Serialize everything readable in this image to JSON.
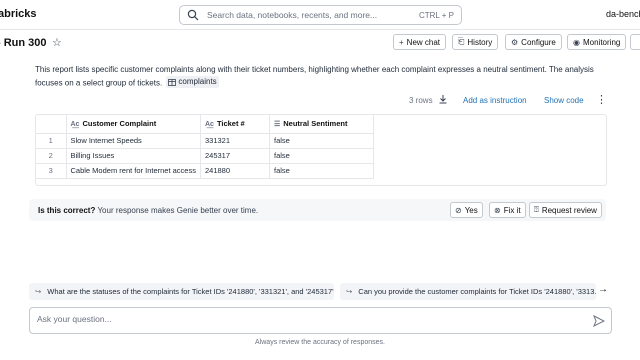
{
  "topbar": {
    "brand": "abricks",
    "search_placeholder": "Search data, notebooks, recents, and more...",
    "search_shortcut": "CTRL + P",
    "workspace": "da-bench"
  },
  "titlebar": {
    "title": "- Run 300",
    "buttons": {
      "new_chat": "New chat",
      "history": "History",
      "configure": "Configure",
      "monitoring": "Monitoring"
    }
  },
  "message": {
    "text": "This report lists specific customer complaints along with their ticket numbers, highlighting whether each complaint expresses a neutral sentiment. The analysis focuses on a select group of tickets.",
    "table_chip": "complaints"
  },
  "result_toolbar": {
    "rows": "3 rows",
    "add_instruction": "Add as instruction",
    "show_code": "Show code"
  },
  "table": {
    "columns": [
      "Customer Complaint",
      "Ticket #",
      "Neutral Sentiment"
    ],
    "rows": [
      {
        "idx": "1",
        "complaint": "Slow Internet Speeds",
        "ticket": "331321",
        "neutral": "false"
      },
      {
        "idx": "2",
        "complaint": "Billing Issues",
        "ticket": "245317",
        "neutral": "false"
      },
      {
        "idx": "3",
        "complaint": "Cable Modem rent for Internet access",
        "ticket": "241880",
        "neutral": "false"
      }
    ]
  },
  "feedback": {
    "question": "Is this correct?",
    "note": "Your response makes Genie better over time.",
    "yes": "Yes",
    "fix_it": "Fix it",
    "request_review": "Request review"
  },
  "suggestions": [
    "What are the statuses of the complaints for Ticket IDs '241880', '331321', and '245317'?",
    "Can you provide the customer complaints for Ticket IDs '241880', '3313..."
  ],
  "ask": {
    "placeholder": "Ask your question..."
  },
  "footnote": "Always review the accuracy of responses."
}
